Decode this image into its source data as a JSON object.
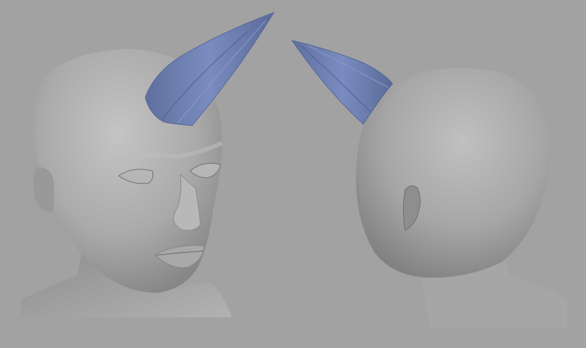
{
  "scene": {
    "background_color": "#a2a2a2",
    "model_color": "#a8a8a8",
    "horn_color": "#6f81b4",
    "views": [
      {
        "name": "front-three-quarter-view",
        "objects": [
          "head",
          "horn",
          "ear",
          "eyes",
          "nose",
          "lips"
        ]
      },
      {
        "name": "back-three-quarter-view",
        "objects": [
          "head",
          "horn",
          "ear"
        ]
      }
    ]
  }
}
